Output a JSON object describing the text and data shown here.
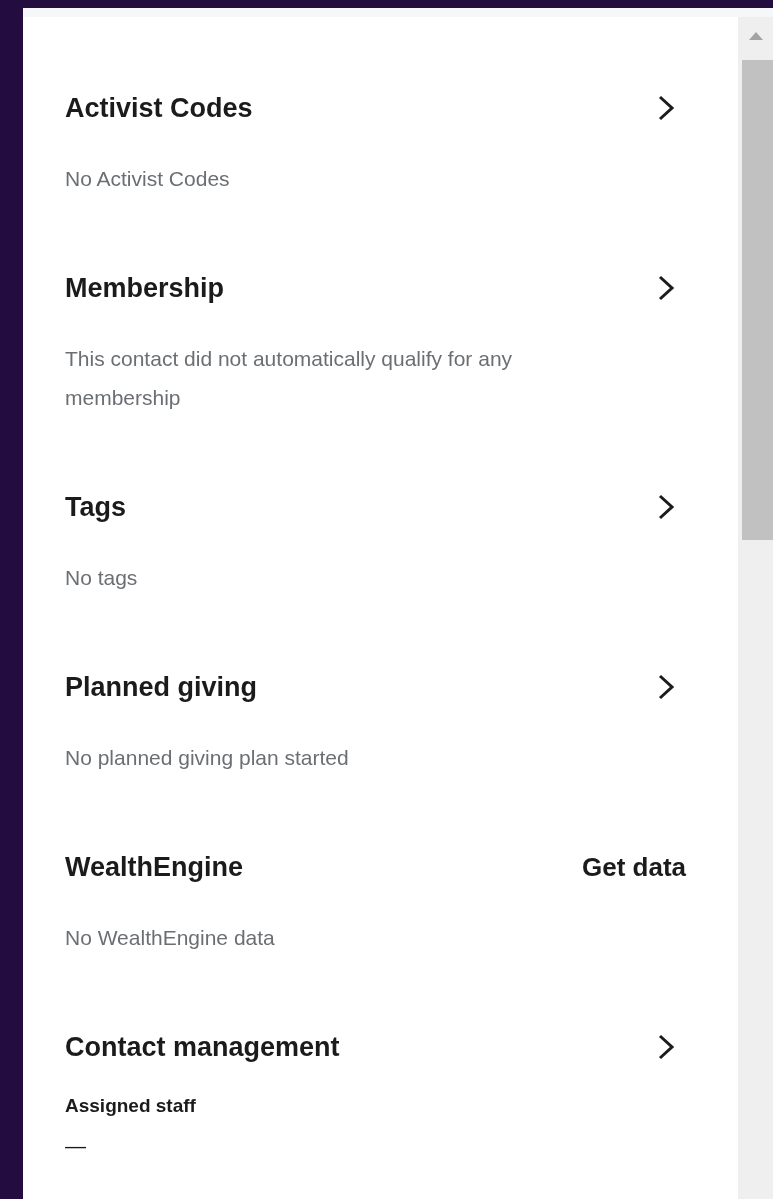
{
  "sections": [
    {
      "title": "Activist Codes",
      "kind": "link",
      "description": "No Activist Codes"
    },
    {
      "title": "Membership",
      "kind": "link",
      "description": "This contact did not automatically qualify for any membership"
    },
    {
      "title": "Tags",
      "kind": "link",
      "description": "No tags"
    },
    {
      "title": "Planned giving",
      "kind": "link",
      "description": "No planned giving plan started"
    },
    {
      "title": "WealthEngine",
      "kind": "action",
      "action": "Get data",
      "description": "No WealthEngine data"
    },
    {
      "title": "Contact management",
      "kind": "link",
      "fields": [
        {
          "label": "Assigned staff",
          "value": "—"
        }
      ]
    }
  ]
}
